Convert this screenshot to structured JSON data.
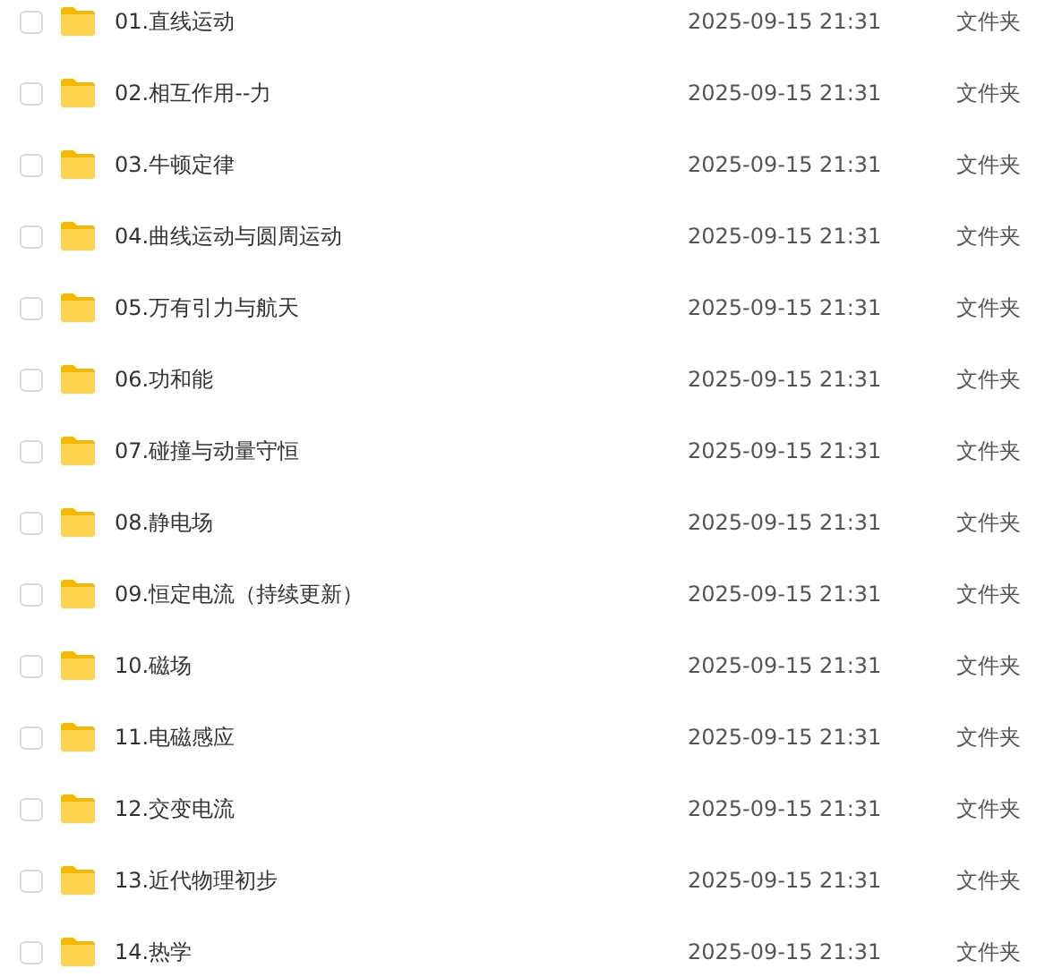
{
  "files": [
    {
      "name": "01.直线运动",
      "modified": "2025-09-15 21:31",
      "type": "文件夹",
      "checked": false
    },
    {
      "name": "02.相互作用--力",
      "modified": "2025-09-15 21:31",
      "type": "文件夹",
      "checked": false
    },
    {
      "name": "03.牛顿定律",
      "modified": "2025-09-15 21:31",
      "type": "文件夹",
      "checked": false
    },
    {
      "name": "04.曲线运动与圆周运动",
      "modified": "2025-09-15 21:31",
      "type": "文件夹",
      "checked": false
    },
    {
      "name": "05.万有引力与航天",
      "modified": "2025-09-15 21:31",
      "type": "文件夹",
      "checked": false
    },
    {
      "name": "06.功和能",
      "modified": "2025-09-15 21:31",
      "type": "文件夹",
      "checked": false
    },
    {
      "name": "07.碰撞与动量守恒",
      "modified": "2025-09-15 21:31",
      "type": "文件夹",
      "checked": false
    },
    {
      "name": "08.静电场",
      "modified": "2025-09-15 21:31",
      "type": "文件夹",
      "checked": false
    },
    {
      "name": "09.恒定电流（持续更新）",
      "modified": "2025-09-15 21:31",
      "type": "文件夹",
      "checked": false
    },
    {
      "name": "10.磁场",
      "modified": "2025-09-15 21:31",
      "type": "文件夹",
      "checked": false
    },
    {
      "name": "11.电磁感应",
      "modified": "2025-09-15 21:31",
      "type": "文件夹",
      "checked": false
    },
    {
      "name": "12.交变电流",
      "modified": "2025-09-15 21:31",
      "type": "文件夹",
      "checked": false
    },
    {
      "name": "13.近代物理初步",
      "modified": "2025-09-15 21:31",
      "type": "文件夹",
      "checked": false
    },
    {
      "name": "14.热学",
      "modified": "2025-09-15 21:31",
      "type": "文件夹",
      "checked": false
    }
  ]
}
